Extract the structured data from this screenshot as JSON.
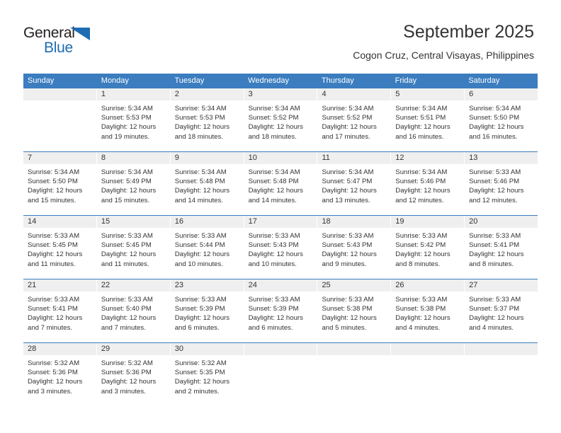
{
  "brand": {
    "name_part1": "General",
    "name_part2": "Blue",
    "triangle_icon": "triangle-icon",
    "colors": {
      "blue": "#1d6cb4",
      "dark": "#231f20"
    }
  },
  "header": {
    "title": "September 2025",
    "subtitle": "Cogon Cruz, Central Visayas, Philippines"
  },
  "calendar": {
    "header_color": "#3b7dbf",
    "weekdays": [
      "Sunday",
      "Monday",
      "Tuesday",
      "Wednesday",
      "Thursday",
      "Friday",
      "Saturday"
    ],
    "weeks": [
      [
        {
          "day": "",
          "sunrise": "",
          "sunset": "",
          "daylight_line1": "",
          "daylight_line2": ""
        },
        {
          "day": "1",
          "sunrise": "Sunrise: 5:34 AM",
          "sunset": "Sunset: 5:53 PM",
          "daylight_line1": "Daylight: 12 hours",
          "daylight_line2": "and 19 minutes."
        },
        {
          "day": "2",
          "sunrise": "Sunrise: 5:34 AM",
          "sunset": "Sunset: 5:53 PM",
          "daylight_line1": "Daylight: 12 hours",
          "daylight_line2": "and 18 minutes."
        },
        {
          "day": "3",
          "sunrise": "Sunrise: 5:34 AM",
          "sunset": "Sunset: 5:52 PM",
          "daylight_line1": "Daylight: 12 hours",
          "daylight_line2": "and 18 minutes."
        },
        {
          "day": "4",
          "sunrise": "Sunrise: 5:34 AM",
          "sunset": "Sunset: 5:52 PM",
          "daylight_line1": "Daylight: 12 hours",
          "daylight_line2": "and 17 minutes."
        },
        {
          "day": "5",
          "sunrise": "Sunrise: 5:34 AM",
          "sunset": "Sunset: 5:51 PM",
          "daylight_line1": "Daylight: 12 hours",
          "daylight_line2": "and 16 minutes."
        },
        {
          "day": "6",
          "sunrise": "Sunrise: 5:34 AM",
          "sunset": "Sunset: 5:50 PM",
          "daylight_line1": "Daylight: 12 hours",
          "daylight_line2": "and 16 minutes."
        }
      ],
      [
        {
          "day": "7",
          "sunrise": "Sunrise: 5:34 AM",
          "sunset": "Sunset: 5:50 PM",
          "daylight_line1": "Daylight: 12 hours",
          "daylight_line2": "and 15 minutes."
        },
        {
          "day": "8",
          "sunrise": "Sunrise: 5:34 AM",
          "sunset": "Sunset: 5:49 PM",
          "daylight_line1": "Daylight: 12 hours",
          "daylight_line2": "and 15 minutes."
        },
        {
          "day": "9",
          "sunrise": "Sunrise: 5:34 AM",
          "sunset": "Sunset: 5:48 PM",
          "daylight_line1": "Daylight: 12 hours",
          "daylight_line2": "and 14 minutes."
        },
        {
          "day": "10",
          "sunrise": "Sunrise: 5:34 AM",
          "sunset": "Sunset: 5:48 PM",
          "daylight_line1": "Daylight: 12 hours",
          "daylight_line2": "and 14 minutes."
        },
        {
          "day": "11",
          "sunrise": "Sunrise: 5:34 AM",
          "sunset": "Sunset: 5:47 PM",
          "daylight_line1": "Daylight: 12 hours",
          "daylight_line2": "and 13 minutes."
        },
        {
          "day": "12",
          "sunrise": "Sunrise: 5:34 AM",
          "sunset": "Sunset: 5:46 PM",
          "daylight_line1": "Daylight: 12 hours",
          "daylight_line2": "and 12 minutes."
        },
        {
          "day": "13",
          "sunrise": "Sunrise: 5:33 AM",
          "sunset": "Sunset: 5:46 PM",
          "daylight_line1": "Daylight: 12 hours",
          "daylight_line2": "and 12 minutes."
        }
      ],
      [
        {
          "day": "14",
          "sunrise": "Sunrise: 5:33 AM",
          "sunset": "Sunset: 5:45 PM",
          "daylight_line1": "Daylight: 12 hours",
          "daylight_line2": "and 11 minutes."
        },
        {
          "day": "15",
          "sunrise": "Sunrise: 5:33 AM",
          "sunset": "Sunset: 5:45 PM",
          "daylight_line1": "Daylight: 12 hours",
          "daylight_line2": "and 11 minutes."
        },
        {
          "day": "16",
          "sunrise": "Sunrise: 5:33 AM",
          "sunset": "Sunset: 5:44 PM",
          "daylight_line1": "Daylight: 12 hours",
          "daylight_line2": "and 10 minutes."
        },
        {
          "day": "17",
          "sunrise": "Sunrise: 5:33 AM",
          "sunset": "Sunset: 5:43 PM",
          "daylight_line1": "Daylight: 12 hours",
          "daylight_line2": "and 10 minutes."
        },
        {
          "day": "18",
          "sunrise": "Sunrise: 5:33 AM",
          "sunset": "Sunset: 5:43 PM",
          "daylight_line1": "Daylight: 12 hours",
          "daylight_line2": "and 9 minutes."
        },
        {
          "day": "19",
          "sunrise": "Sunrise: 5:33 AM",
          "sunset": "Sunset: 5:42 PM",
          "daylight_line1": "Daylight: 12 hours",
          "daylight_line2": "and 8 minutes."
        },
        {
          "day": "20",
          "sunrise": "Sunrise: 5:33 AM",
          "sunset": "Sunset: 5:41 PM",
          "daylight_line1": "Daylight: 12 hours",
          "daylight_line2": "and 8 minutes."
        }
      ],
      [
        {
          "day": "21",
          "sunrise": "Sunrise: 5:33 AM",
          "sunset": "Sunset: 5:41 PM",
          "daylight_line1": "Daylight: 12 hours",
          "daylight_line2": "and 7 minutes."
        },
        {
          "day": "22",
          "sunrise": "Sunrise: 5:33 AM",
          "sunset": "Sunset: 5:40 PM",
          "daylight_line1": "Daylight: 12 hours",
          "daylight_line2": "and 7 minutes."
        },
        {
          "day": "23",
          "sunrise": "Sunrise: 5:33 AM",
          "sunset": "Sunset: 5:39 PM",
          "daylight_line1": "Daylight: 12 hours",
          "daylight_line2": "and 6 minutes."
        },
        {
          "day": "24",
          "sunrise": "Sunrise: 5:33 AM",
          "sunset": "Sunset: 5:39 PM",
          "daylight_line1": "Daylight: 12 hours",
          "daylight_line2": "and 6 minutes."
        },
        {
          "day": "25",
          "sunrise": "Sunrise: 5:33 AM",
          "sunset": "Sunset: 5:38 PM",
          "daylight_line1": "Daylight: 12 hours",
          "daylight_line2": "and 5 minutes."
        },
        {
          "day": "26",
          "sunrise": "Sunrise: 5:33 AM",
          "sunset": "Sunset: 5:38 PM",
          "daylight_line1": "Daylight: 12 hours",
          "daylight_line2": "and 4 minutes."
        },
        {
          "day": "27",
          "sunrise": "Sunrise: 5:33 AM",
          "sunset": "Sunset: 5:37 PM",
          "daylight_line1": "Daylight: 12 hours",
          "daylight_line2": "and 4 minutes."
        }
      ],
      [
        {
          "day": "28",
          "sunrise": "Sunrise: 5:32 AM",
          "sunset": "Sunset: 5:36 PM",
          "daylight_line1": "Daylight: 12 hours",
          "daylight_line2": "and 3 minutes."
        },
        {
          "day": "29",
          "sunrise": "Sunrise: 5:32 AM",
          "sunset": "Sunset: 5:36 PM",
          "daylight_line1": "Daylight: 12 hours",
          "daylight_line2": "and 3 minutes."
        },
        {
          "day": "30",
          "sunrise": "Sunrise: 5:32 AM",
          "sunset": "Sunset: 5:35 PM",
          "daylight_line1": "Daylight: 12 hours",
          "daylight_line2": "and 2 minutes."
        },
        {
          "day": "",
          "sunrise": "",
          "sunset": "",
          "daylight_line1": "",
          "daylight_line2": ""
        },
        {
          "day": "",
          "sunrise": "",
          "sunset": "",
          "daylight_line1": "",
          "daylight_line2": ""
        },
        {
          "day": "",
          "sunrise": "",
          "sunset": "",
          "daylight_line1": "",
          "daylight_line2": ""
        },
        {
          "day": "",
          "sunrise": "",
          "sunset": "",
          "daylight_line1": "",
          "daylight_line2": ""
        }
      ]
    ]
  }
}
